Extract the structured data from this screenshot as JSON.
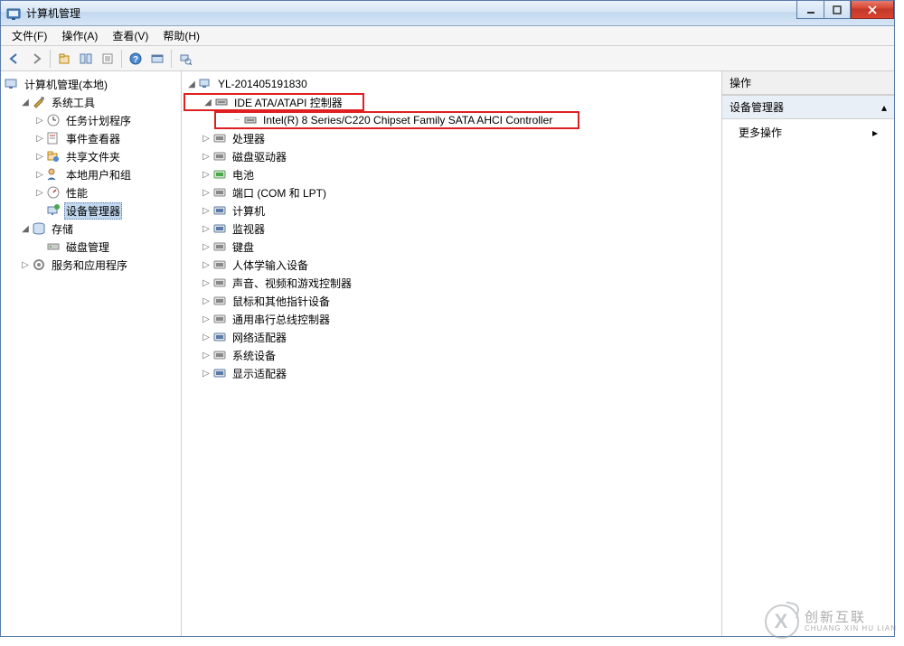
{
  "window": {
    "title": "计算机管理"
  },
  "menubar": [
    {
      "label": "文件(F)",
      "key": "file"
    },
    {
      "label": "操作(A)",
      "key": "action"
    },
    {
      "label": "查看(V)",
      "key": "view"
    },
    {
      "label": "帮助(H)",
      "key": "help"
    }
  ],
  "toolbar_icons": [
    "back",
    "forward",
    "up",
    "show-hide",
    "properties",
    "refresh",
    "help",
    "console",
    "find"
  ],
  "left_tree": {
    "root": "计算机管理(本地)",
    "groups": [
      {
        "label": "系统工具",
        "expanded": true,
        "children": [
          {
            "label": "任务计划程序",
            "icon": "clock"
          },
          {
            "label": "事件查看器",
            "icon": "event"
          },
          {
            "label": "共享文件夹",
            "icon": "share"
          },
          {
            "label": "本地用户和组",
            "icon": "users"
          },
          {
            "label": "性能",
            "icon": "perf"
          },
          {
            "label": "设备管理器",
            "icon": "device",
            "selected": true
          }
        ]
      },
      {
        "label": "存储",
        "expanded": true,
        "children": [
          {
            "label": "磁盘管理",
            "icon": "disk"
          }
        ]
      },
      {
        "label": "服务和应用程序",
        "expanded": false,
        "children": []
      }
    ]
  },
  "center_tree": {
    "root": "YL-201405191830",
    "categories": [
      {
        "label": "IDE ATA/ATAPI 控制器",
        "expanded": true,
        "highlighted": true,
        "children": [
          {
            "label": "Intel(R) 8 Series/C220 Chipset Family SATA AHCI Controller",
            "highlighted": true
          }
        ]
      },
      {
        "label": "处理器"
      },
      {
        "label": "磁盘驱动器"
      },
      {
        "label": "电池"
      },
      {
        "label": "端口 (COM 和 LPT)"
      },
      {
        "label": "计算机"
      },
      {
        "label": "监视器"
      },
      {
        "label": "键盘"
      },
      {
        "label": "人体学输入设备"
      },
      {
        "label": "声音、视频和游戏控制器"
      },
      {
        "label": "鼠标和其他指针设备"
      },
      {
        "label": "通用串行总线控制器"
      },
      {
        "label": "网络适配器"
      },
      {
        "label": "系统设备"
      },
      {
        "label": "显示适配器"
      }
    ]
  },
  "right_panel": {
    "header": "操作",
    "section": "设备管理器",
    "action": "更多操作"
  },
  "watermark": {
    "brand_cn": "创新互联",
    "brand_en": "CHUANG XIN HU LIAN",
    "logo_letter": "X"
  }
}
